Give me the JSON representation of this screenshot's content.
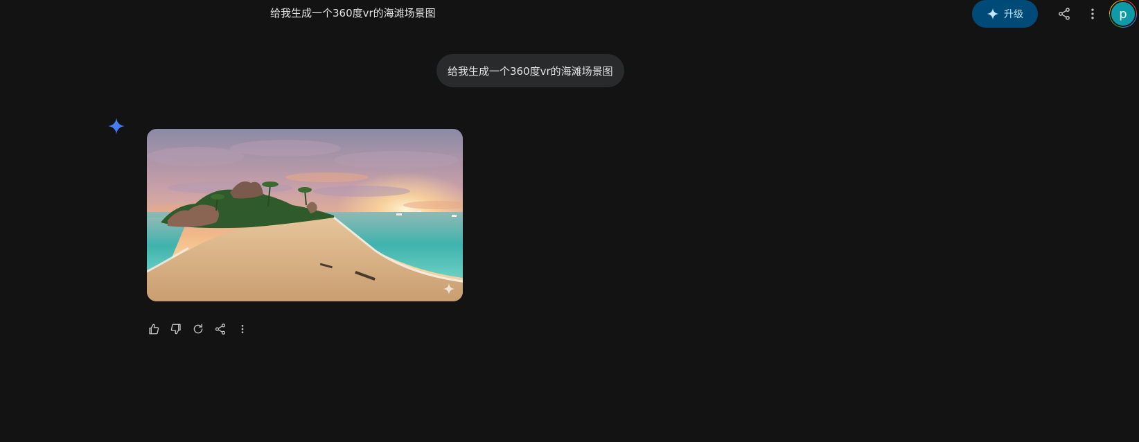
{
  "header": {
    "chat_title": "给我生成一个360度vr的海滩场景图",
    "upgrade_label": "升级",
    "avatar_letter": "p"
  },
  "conversation": {
    "user_prompt": "给我生成一个360度vr的海滩场景图"
  },
  "icons": {
    "upgrade": "sparkle-icon",
    "share": "share-icon",
    "more": "more-vert-icon",
    "assistant": "gemini-sparkle-icon",
    "actions": [
      "thumb-up-icon",
      "thumb-down-icon",
      "regenerate-icon",
      "share-icon",
      "more-vert-icon"
    ]
  },
  "colors": {
    "background": "#131313",
    "upgrade_button": "#004a77",
    "bubble": "#282a2c",
    "accent": "#4285f4"
  }
}
